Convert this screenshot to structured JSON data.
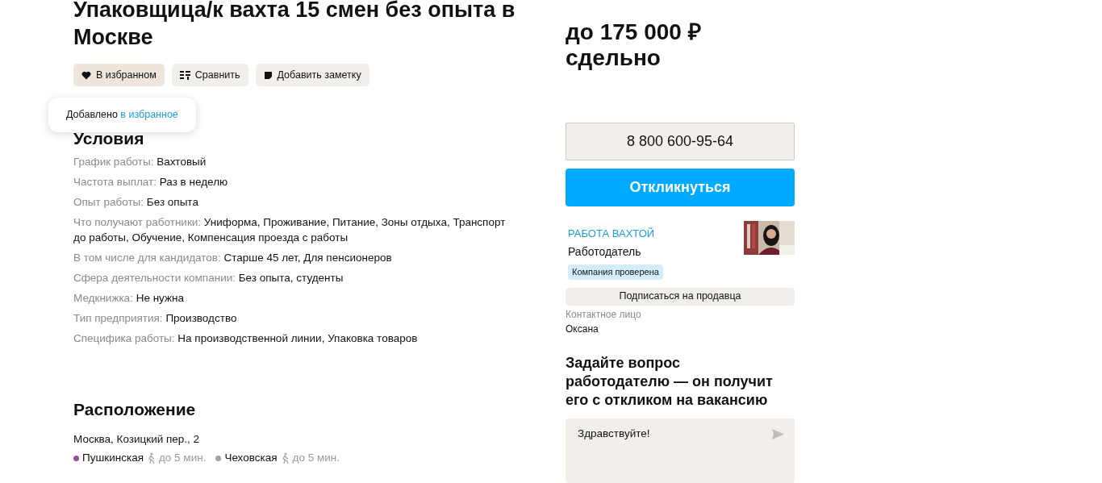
{
  "title": "Упаковщица/к вахта 15 смен без опыта в Москве",
  "actions": [
    {
      "kind": "favorite",
      "label": "В избранном",
      "selected": true
    },
    {
      "kind": "compare",
      "label": "Сравнить"
    },
    {
      "kind": "note",
      "label": "Добавить заметку"
    }
  ],
  "tooltip": {
    "text": "Добавлено",
    "link": "в избранное"
  },
  "conditions": {
    "heading": "Условия",
    "items": [
      {
        "label": "График работы:",
        "value": "Вахтовый"
      },
      {
        "label": "Частота выплат:",
        "value": "Раз в неделю"
      },
      {
        "label": "Опыт работы:",
        "value": "Без опыта"
      },
      {
        "label": "Что получают работники:",
        "value": "Униформа, Проживание, Питание, Зоны отдыха, Транспорт до работы, Обучение, Компенсация проезда с работы"
      },
      {
        "label": "В том числе для кандидатов:",
        "value": "Старше 45 лет, Для пенсионеров"
      },
      {
        "label": "Сфера деятельности компании:",
        "value": "Без опыта, студенты"
      },
      {
        "label": "Медкнижка:",
        "value": "Не нужна"
      },
      {
        "label": "Тип предприятия:",
        "value": "Производство"
      },
      {
        "label": "Специфика работы:",
        "value": "На производственной линии, Упаковка товаров"
      }
    ]
  },
  "location": {
    "heading": "Расположение",
    "address": "Москва, Козицкий пер., 2",
    "stations": [
      {
        "name": "Пушкинская",
        "time": "до 5 мин.",
        "color": "#9b4d9e"
      },
      {
        "name": "Чеховская",
        "time": "до 5 мин.",
        "color": "#a3a3a3"
      }
    ]
  },
  "salary": {
    "amount": "до 175 000 ₽",
    "type": "сдельно"
  },
  "phone": "8 800 600-95-64",
  "respond_button": "Откликнуться",
  "employer": {
    "name": "РАБОТА ВАХТОЙ",
    "role": "Работодатель",
    "badge": "Компания проверена"
  },
  "subscribe_button": "Подписаться на продавца",
  "contact": {
    "label": "Контактное лицо",
    "name": "Оксана"
  },
  "question": {
    "heading": "Задайте вопрос работодателю — он получит его с откликом на вакансию",
    "value": "Здравствуйте!"
  }
}
